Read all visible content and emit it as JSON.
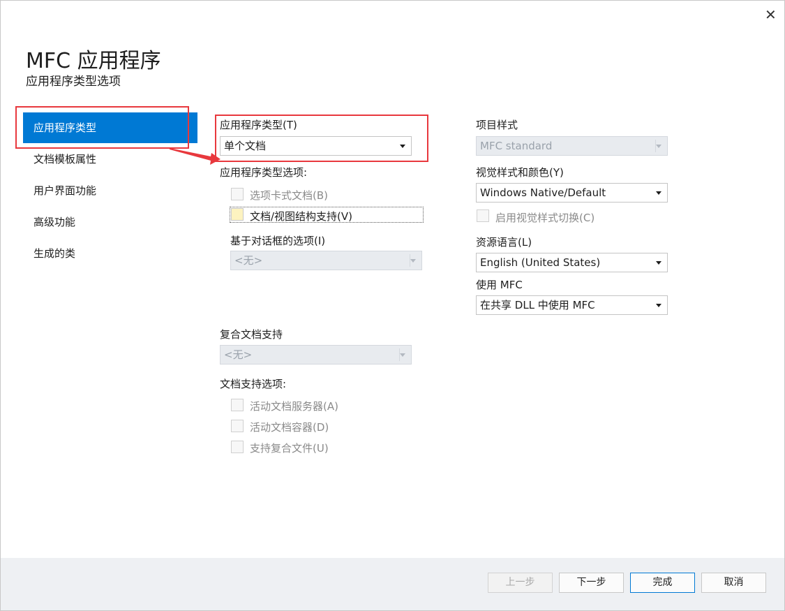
{
  "window": {
    "close_glyph": "✕"
  },
  "header": {
    "title": "MFC 应用程序",
    "subtitle": "应用程序类型选项"
  },
  "nav": {
    "items": [
      {
        "label": "应用程序类型",
        "active": true
      },
      {
        "label": "文档模板属性"
      },
      {
        "label": "用户界面功能"
      },
      {
        "label": "高级功能"
      },
      {
        "label": "生成的类"
      }
    ]
  },
  "middle": {
    "app_type": {
      "label": "应用程序类型(T)",
      "value": "单个文档"
    },
    "app_type_options": {
      "label": "应用程序类型选项:",
      "tabbed_docs": {
        "label": "选项卡式文档(B)",
        "checked": false,
        "enabled": false
      },
      "doc_view": {
        "label": "文档/视图结构支持(V)",
        "checked": false,
        "enabled": true
      }
    },
    "dialog_options": {
      "label": "基于对话框的选项(I)",
      "value": "<无>"
    },
    "compound": {
      "label": "复合文档支持",
      "value": "<无>"
    },
    "doc_support": {
      "label": "文档支持选项:",
      "items": [
        {
          "label": "活动文档服务器(A)",
          "checked": false
        },
        {
          "label": "活动文档容器(D)",
          "checked": false
        },
        {
          "label": "支持复合文件(U)",
          "checked": false
        }
      ]
    }
  },
  "right": {
    "project_style": {
      "label": "项目样式",
      "value": "MFC standard"
    },
    "visual_style": {
      "label": "视觉样式和颜色(Y)",
      "value": "Windows Native/Default"
    },
    "visual_toggle": {
      "label": "启用视觉样式切换(C)",
      "checked": false
    },
    "resource_lang": {
      "label": "资源语言(L)",
      "value": "English (United States)"
    },
    "use_mfc": {
      "label": "使用 MFC",
      "value": "在共享 DLL 中使用 MFC"
    }
  },
  "footer": {
    "prev": "上一步",
    "next": "下一步",
    "finish": "完成",
    "cancel": "取消"
  },
  "colors": {
    "accent": "#0079d4",
    "annotation": "#e8383d",
    "footer_bg": "#eef0f3"
  }
}
